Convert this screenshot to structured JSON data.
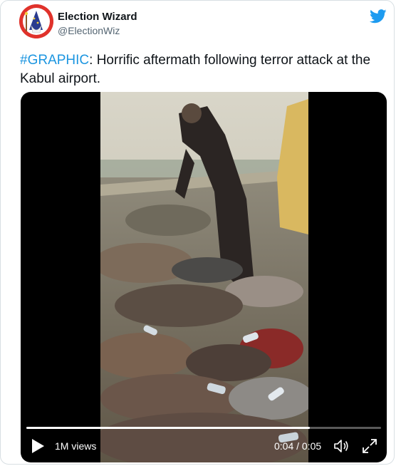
{
  "user": {
    "name": "Election Wizard",
    "handle": "@ElectionWiz",
    "avatar_color": "#e0322b"
  },
  "tweet": {
    "hashtag": "#GRAPHIC",
    "text": ": Horrific aftermath following terror attack at the Kabul airport."
  },
  "video": {
    "views": "1M views",
    "time": "0:04 / 0:05",
    "progress": 0.8
  },
  "colors": {
    "link": "#1b95e0",
    "twitter_blue": "#1d9bf0"
  },
  "icons": [
    "twitter-bird-icon",
    "play-icon",
    "volume-icon",
    "fullscreen-icon",
    "wizard-avatar-icon"
  ]
}
